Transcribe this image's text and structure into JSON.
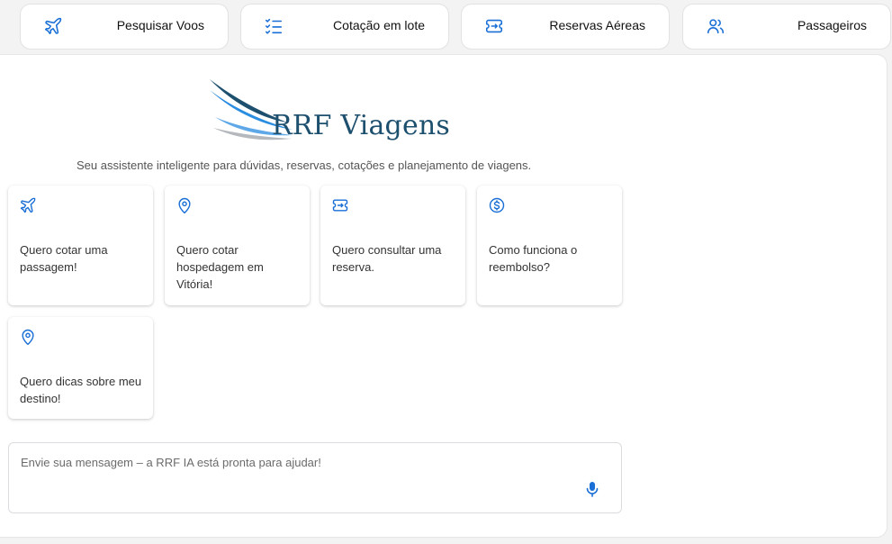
{
  "nav": {
    "tabs": [
      {
        "label": "Pesquisar Voos",
        "icon": "plane-icon"
      },
      {
        "label": "Cotação em lote",
        "icon": "checklist-icon"
      },
      {
        "label": "Reservas Aéreas",
        "icon": "ticket-icon"
      },
      {
        "label": "Passageiros",
        "icon": "users-icon"
      }
    ]
  },
  "brand": {
    "name": "RRF Viagens",
    "subtitle": "Seu assistente inteligente para dúvidas, reservas, cotações e planejamento de viagens."
  },
  "suggestions": [
    {
      "text": "Quero cotar uma passagem!",
      "icon": "plane-icon"
    },
    {
      "text": "Quero cotar hospedagem em Vitória!",
      "icon": "map-pin-icon"
    },
    {
      "text": "Quero consultar uma reserva.",
      "icon": "ticket-icon"
    },
    {
      "text": "Como funciona o reembolso?",
      "icon": "dollar-circle-icon"
    },
    {
      "text": "Quero dicas sobre meu destino!",
      "icon": "map-pin-icon"
    }
  ],
  "chat": {
    "placeholder": "Envie sua mensagem – a RRF IA está pronta para ajudar!",
    "value": ""
  },
  "colors": {
    "accent": "#1a6fd6",
    "brand": "#1d4f6e",
    "logo_blue": "#2a8de0",
    "logo_gray": "#b5b8bc"
  }
}
